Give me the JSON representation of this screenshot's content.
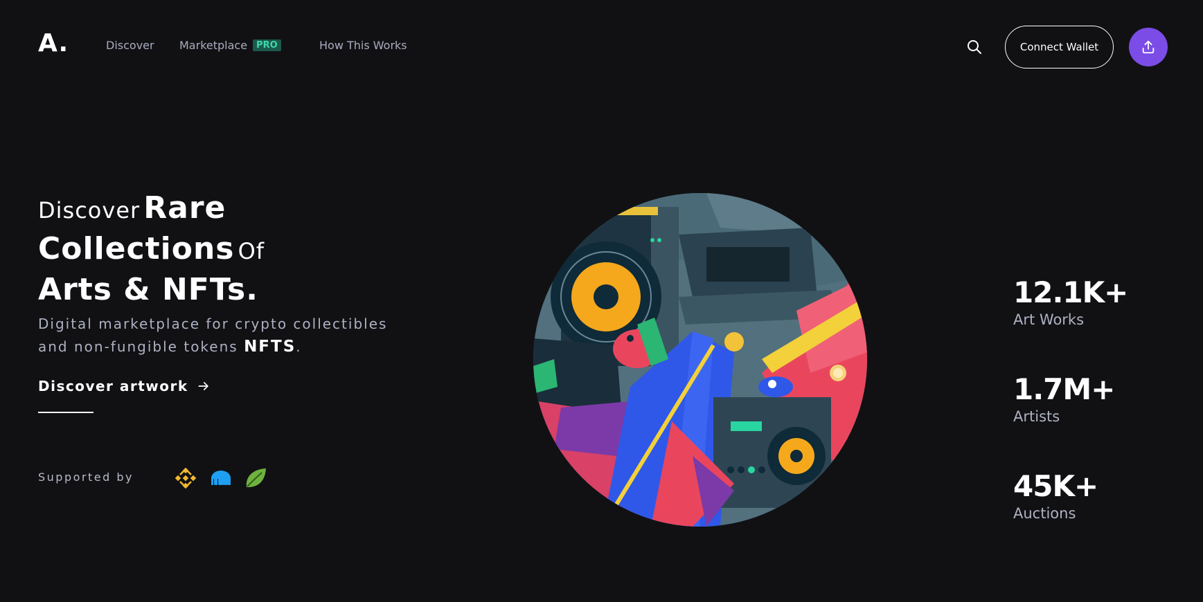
{
  "header": {
    "logo": "A.",
    "nav": {
      "discover": "Discover",
      "marketplace": "Marketplace",
      "pro_badge": "PRO",
      "how_it_works": "How This Works"
    },
    "connect_wallet": "Connect Wallet",
    "icons": {
      "search": "search-icon",
      "upload": "upload-icon"
    }
  },
  "hero": {
    "title": {
      "w1": "Discover",
      "w2": "Rare",
      "w3": "Collections",
      "w4": "Of",
      "w5": "Arts & NFTs."
    },
    "subtitle": {
      "line1": "Digital marketplace for crypto collectibles",
      "line2": "and non-fungible tokens",
      "highlight": "NFTS",
      "end": "."
    },
    "cta_label": "Discover artwork",
    "supported_by": "Supported by",
    "sponsors": [
      "binance-logo",
      "kraken-logo",
      "bitcoin-leaf-logo"
    ]
  },
  "stats": [
    {
      "value": "12.1K+",
      "label": "Art Works"
    },
    {
      "value": "1.7M+",
      "label": "Artists"
    },
    {
      "value": "45K+",
      "label": "Auctions"
    }
  ],
  "colors": {
    "background": "#111114",
    "accent": "#7b4ce6",
    "pro_badge_bg": "#1b5a4c",
    "pro_badge_text": "#3fd8ae",
    "muted_text": "#a9adbd"
  }
}
